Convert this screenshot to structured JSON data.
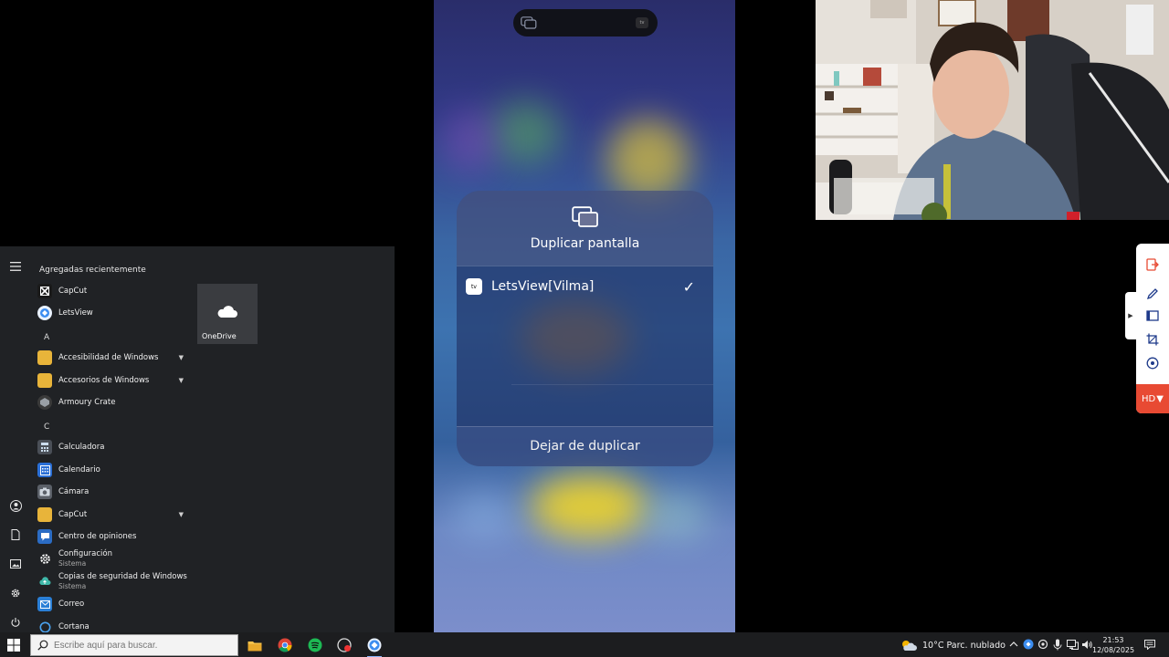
{
  "start_menu": {
    "section_title": "Agregadas recientemente",
    "recent": [
      {
        "label": "CapCut",
        "icon": "capcut-icon"
      },
      {
        "label": "LetsView",
        "icon": "letsview-icon"
      }
    ],
    "letters": [
      "A",
      "C"
    ],
    "apps": [
      {
        "label": "Accesibilidad de Windows",
        "icon": "folder-icon",
        "expandable": true
      },
      {
        "label": "Accesorios de Windows",
        "icon": "folder-icon",
        "expandable": true
      },
      {
        "label": "Armoury Crate",
        "icon": "armoury-crate-icon"
      },
      {
        "label": "Calculadora",
        "icon": "calculator-icon"
      },
      {
        "label": "Calendario",
        "icon": "calendar-icon"
      },
      {
        "label": "Cámara",
        "icon": "camera-icon"
      },
      {
        "label": "CapCut",
        "icon": "folder-icon",
        "expandable": true
      },
      {
        "label": "Centro de opiniones",
        "icon": "feedback-hub-icon"
      },
      {
        "label": "Configuración",
        "sub": "Sistema",
        "icon": "settings-gear-icon"
      },
      {
        "label": "Copias de seguridad de Windows",
        "sub": "Sistema",
        "icon": "backup-cloud-icon"
      },
      {
        "label": "Correo",
        "icon": "mail-icon"
      },
      {
        "label": "Cortana",
        "icon": "cortana-icon"
      }
    ],
    "tile": {
      "label": "OneDrive",
      "icon": "onedrive-cloud-icon"
    }
  },
  "phone": {
    "panel_title": "Duplicar pantalla",
    "device_name": "LetsView[Vilma]",
    "device_badge": "tv",
    "stop_label": "Dejar de duplicar"
  },
  "sidebar": {
    "hd_label": "HD"
  },
  "taskbar": {
    "search_placeholder": "Escribe aquí para buscar.",
    "weather": "10°C  Parc. nublado",
    "time": "21:53",
    "date": "12/08/2025"
  },
  "colors": {
    "taskbar_bg": "#1c1d1f",
    "start_bg": "#202225",
    "folder": "#e8b43a",
    "hd_accent": "#e84a33"
  }
}
